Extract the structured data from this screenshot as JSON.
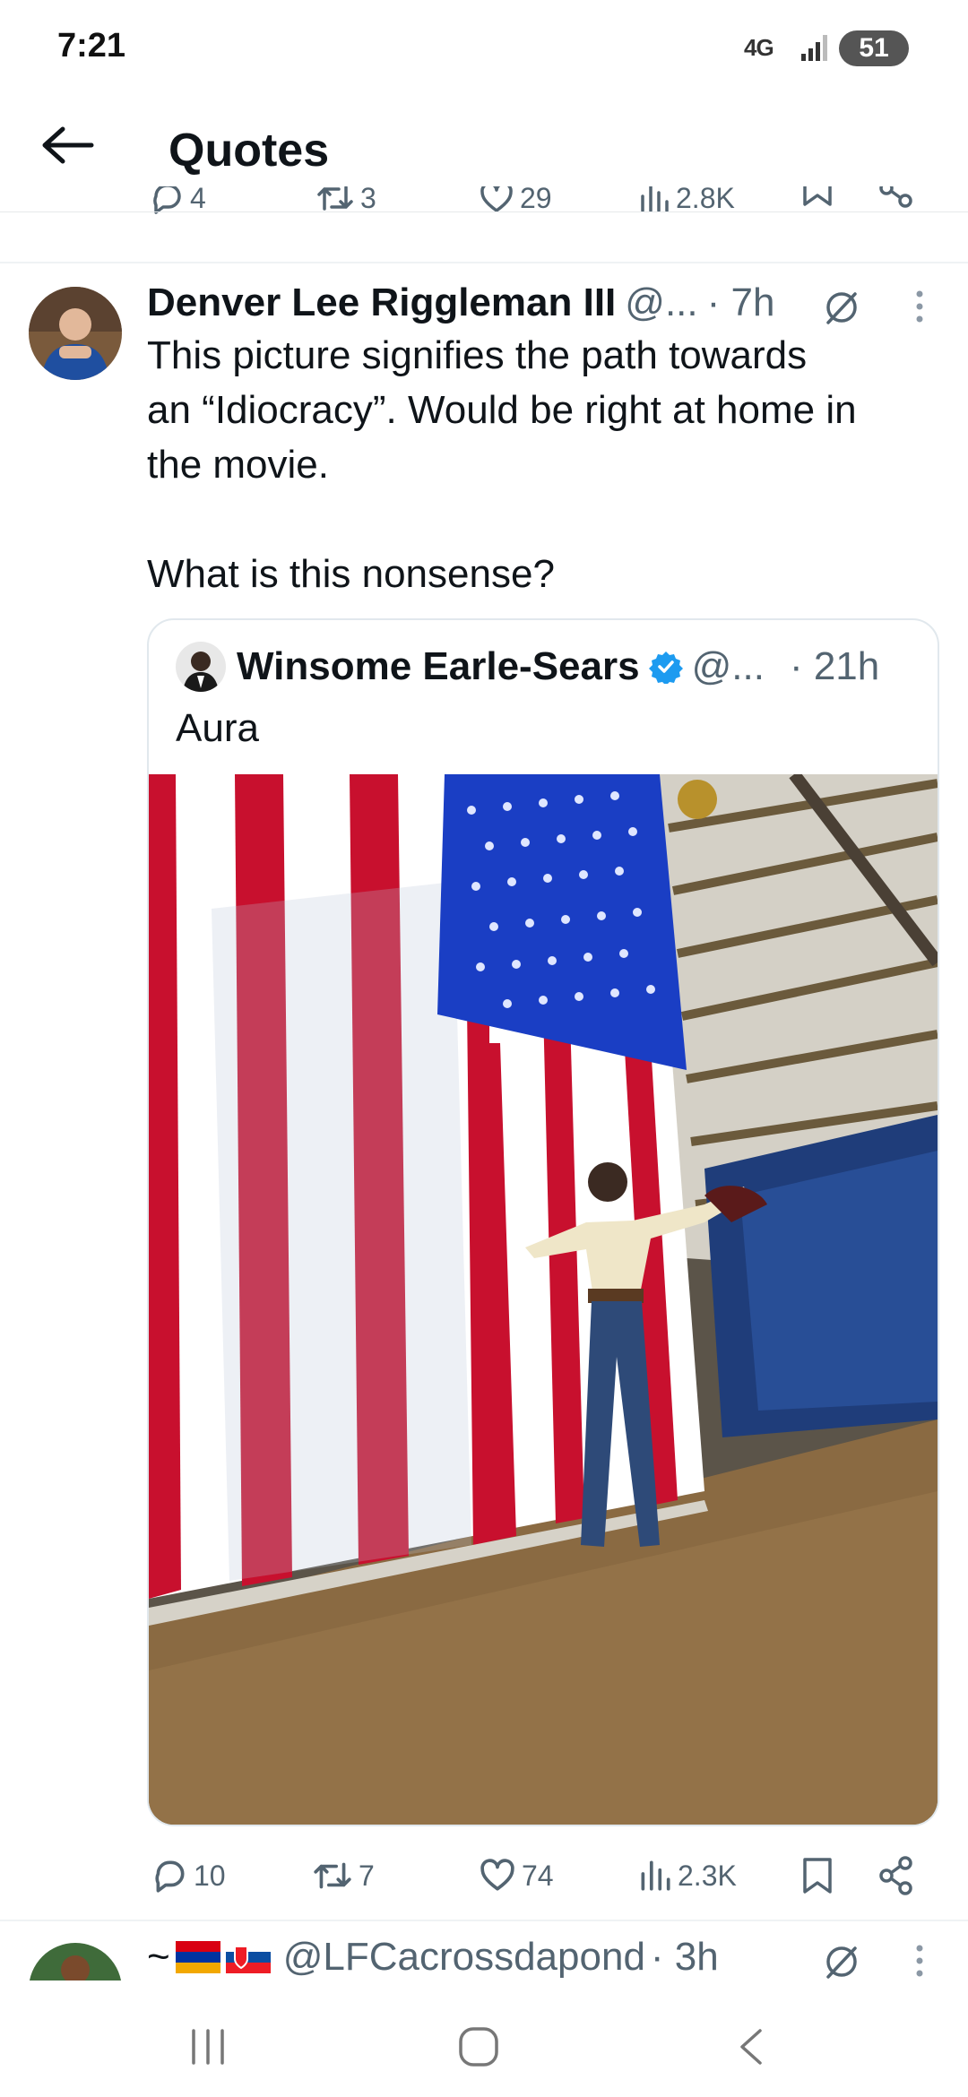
{
  "status_bar": {
    "time": "7:21",
    "network": "4G",
    "battery": "51"
  },
  "header": {
    "title": "Quotes"
  },
  "previous_tweet_actions": {
    "replies": "4",
    "retweets": "3",
    "likes": "29",
    "views": "2.8K"
  },
  "tweet": {
    "author_name": "Denver Lee Riggleman III",
    "handle": "@...",
    "time": "· 7h",
    "text_line1": "This picture signifies the path towards",
    "text_line2": "an “Idiocracy”. Would be right at home in",
    "text_line3": "the movie.",
    "text_line4": "What is this nonsense?",
    "quoted": {
      "author_name": "Winsome Earle-Sears",
      "handle": "@...",
      "time": "· 21h",
      "text": "Aura"
    },
    "actions": {
      "replies": "10",
      "retweets": "7",
      "likes": "74",
      "views": "2.3K"
    }
  },
  "next_tweet": {
    "prefix": "~",
    "handle": "@LFCacrossdapond",
    "time": "· 3h"
  },
  "colors": {
    "accent": "#1d9bf0",
    "text_primary": "#0f1419",
    "text_secondary": "#536471",
    "flag_red": "#c8102e",
    "flag_blue": "#1a3ec4"
  }
}
